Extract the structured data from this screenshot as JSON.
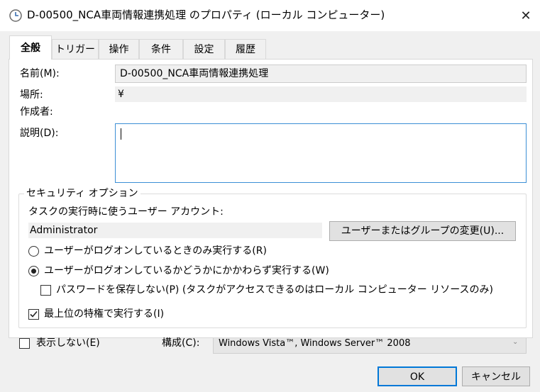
{
  "window": {
    "title": "D-00500_NCA車両情報連携処理 のプロパティ (ローカル コンピューター)",
    "close_glyph": "✕"
  },
  "tabs": [
    {
      "label": "全般",
      "active": true
    },
    {
      "label": "トリガー",
      "active": false
    },
    {
      "label": "操作",
      "active": false
    },
    {
      "label": "条件",
      "active": false
    },
    {
      "label": "設定",
      "active": false
    },
    {
      "label": "履歴",
      "active": false
    }
  ],
  "general": {
    "name_label": "名前(M):",
    "name_value": "D-00500_NCA車両情報連携処理",
    "location_label": "場所:",
    "location_value": "¥",
    "author_label": "作成者:",
    "author_value": "",
    "description_label": "説明(D):",
    "description_value": ""
  },
  "security": {
    "group_title": "セキュリティ オプション",
    "account_prompt": "タスクの実行時に使うユーザー アカウント:",
    "account_value": "Administrator",
    "change_button": "ユーザーまたはグループの変更(U)...",
    "radio_logged_on_only": {
      "label": "ユーザーがログオンしているときのみ実行する(R)",
      "checked": false
    },
    "radio_whether_logged_on": {
      "label": "ユーザーがログオンしているかどうかにかかわらず実行する(W)",
      "checked": true
    },
    "check_no_store_password": {
      "label": "パスワードを保存しない(P) (タスクがアクセスできるのはローカル コンピューター リソースのみ)",
      "checked": false
    },
    "check_highest_privileges": {
      "label": "最上位の特権で実行する(I)",
      "checked": true
    }
  },
  "bottom": {
    "hidden_label": "表示しない(E)",
    "hidden_checked": false,
    "configure_label": "構成(C):",
    "configure_value": "Windows Vista™, Windows Server™ 2008"
  },
  "buttons": {
    "ok": "OK",
    "cancel": "キャンセル"
  },
  "colors": {
    "focus_blue": "#0078d7",
    "dialog_gray": "#f0f0f0",
    "readonly_gray": "#f0f0f0"
  }
}
